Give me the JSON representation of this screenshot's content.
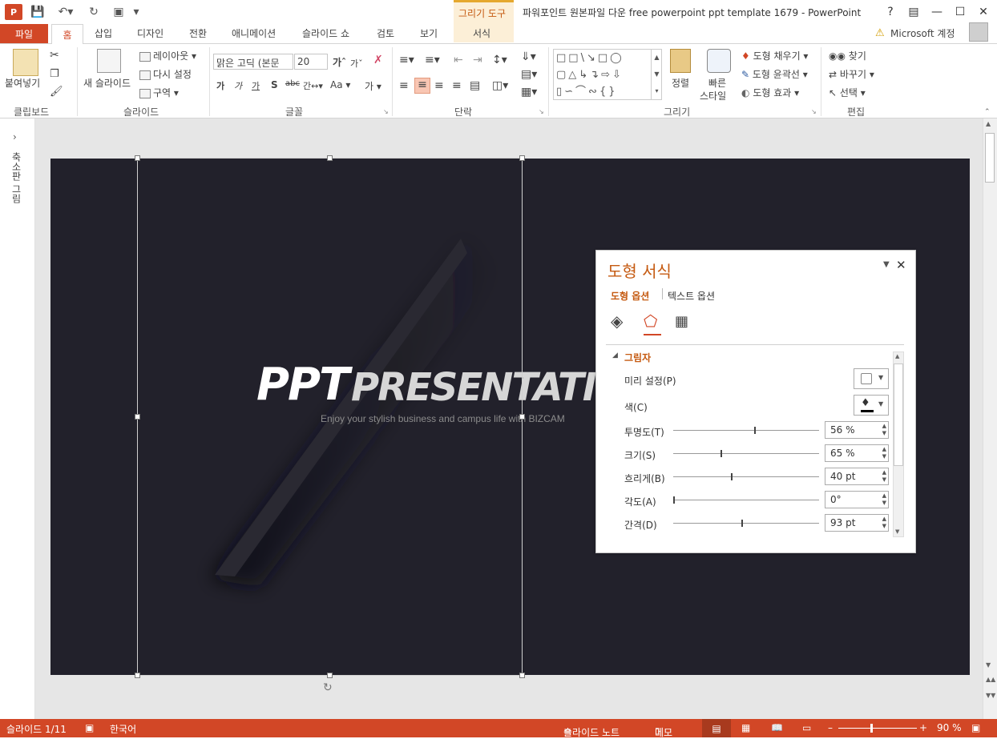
{
  "titlebar": {
    "title": "파워포인트 원본파일 다운 free powerpoint ppt template 1679 - PowerPoint",
    "app_logo": "P",
    "context_tab_group": "그리기 도구",
    "help": "?",
    "controls": [
      "restore-ribbon-icon",
      "minimize-icon",
      "maximize-icon",
      "close-icon"
    ]
  },
  "tabs": {
    "file": "파일",
    "items": [
      "홈",
      "삽입",
      "디자인",
      "전환",
      "애니메이션",
      "슬라이드 쇼",
      "검토",
      "보기",
      "서식"
    ],
    "account": "Microsoft 계정"
  },
  "ribbon": {
    "clipboard": {
      "label": "클립보드",
      "paste": "붙여넣기"
    },
    "slides": {
      "label": "슬라이드",
      "new_slide": "새 슬라이드",
      "layout": "레이아웃",
      "reset": "다시 설정",
      "section": "구역"
    },
    "font": {
      "label": "글꼴",
      "font_name": "맑은 고딕 (본문",
      "font_size": "20",
      "case": "Aa",
      "char_size": "가"
    },
    "paragraph": {
      "label": "단락"
    },
    "drawing": {
      "label": "그리기",
      "arrange": "정렬",
      "quick_styles_1": "빠른",
      "quick_styles_2": "스타일",
      "fill": "도형 채우기",
      "outline": "도형 윤곽선",
      "effects": "도형 효과"
    },
    "editing": {
      "label": "편집",
      "find": "찾기",
      "replace": "바꾸기",
      "select": "선택"
    }
  },
  "leftpane": {
    "collapsed_label": "축소판 그림"
  },
  "slide": {
    "title_ppt": "PPT",
    "title_presentation": "PRESENTATIO",
    "subtitle": "Enjoy your stylish business and campus life with BIZCAM"
  },
  "format_panel": {
    "title": "도형 서식",
    "tab_shape": "도형 옵션",
    "tab_text": "텍스트 옵션",
    "section": "그림자",
    "rows": [
      {
        "label": "미리 설정(P)"
      },
      {
        "label": "색(C)"
      },
      {
        "label": "투명도(T)",
        "value": "56 %",
        "level": 0.56
      },
      {
        "label": "크기(S)",
        "value": "65 %",
        "level": 0.33
      },
      {
        "label": "흐리게(B)",
        "value": "40 pt",
        "level": 0.4
      },
      {
        "label": "각도(A)",
        "value": "0°",
        "level": 0.0
      },
      {
        "label": "간격(D)",
        "value": "93 pt",
        "level": 0.47
      }
    ]
  },
  "status": {
    "slide_num": "슬라이드 1/11",
    "language": "한국어",
    "notes": "슬라이드 노트",
    "comments": "메모",
    "zoom": "90 %"
  },
  "colors": {
    "accent": "#d24726",
    "slide_bg": "#22212b",
    "context": "#c55a11"
  }
}
